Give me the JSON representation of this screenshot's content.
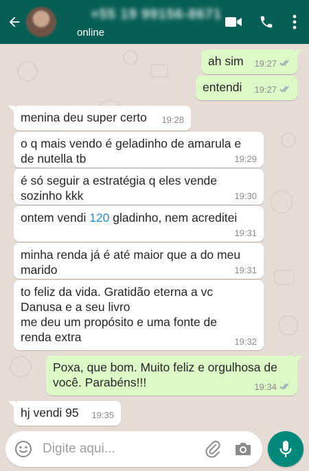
{
  "header": {
    "contact_name": "+55 19 99156-8671",
    "status": "online",
    "icons": [
      "back-arrow-icon",
      "video-call-icon",
      "phone-icon",
      "more-vert-icon"
    ],
    "color": "#075e54"
  },
  "messages": [
    {
      "direction": "out",
      "text": "ah sim",
      "time": "19:27",
      "status": "read"
    },
    {
      "direction": "out",
      "text": "entendi",
      "time": "19:27",
      "status": "read"
    },
    {
      "direction": "in",
      "text": "menina deu super certo",
      "time": "19:28"
    },
    {
      "direction": "in",
      "text": "o q mais vendo é geladinho de amarula e de nutella tb",
      "time": "19:29"
    },
    {
      "direction": "in",
      "text": "é só seguir a estratégia q eles vende sozinho kkk",
      "time": "19:30"
    },
    {
      "direction": "in",
      "text_before": "ontem vendi ",
      "highlight": "120",
      "text_after": " gladinho, nem acreditei",
      "time": "19:31"
    },
    {
      "direction": "in",
      "text": "minha renda já é até maior que a do meu marido",
      "time": "19:31"
    },
    {
      "direction": "in",
      "text": "to feliz da vida. Gratidão eterna a vc Danusa e a seu livro\nme deu um propósito e uma fonte de renda extra",
      "time": "19:32"
    },
    {
      "direction": "out",
      "text": "Poxa, que bom. Muito feliz e orgulhosa de você. Parabéns!!!",
      "time": "19:34",
      "status": "read"
    },
    {
      "direction": "in",
      "text": "hj vendi 95",
      "time": "19:35"
    }
  ],
  "input": {
    "placeholder": "Digite aqui...",
    "value": ""
  },
  "colors": {
    "chat_background": "#e5ddd5",
    "outgoing_bubble": "#dcf8c6",
    "incoming_bubble": "#ffffff",
    "read_ticks": "#8fa3b3",
    "link_number": "#1b8fd4",
    "mic_button": "#00897b"
  }
}
